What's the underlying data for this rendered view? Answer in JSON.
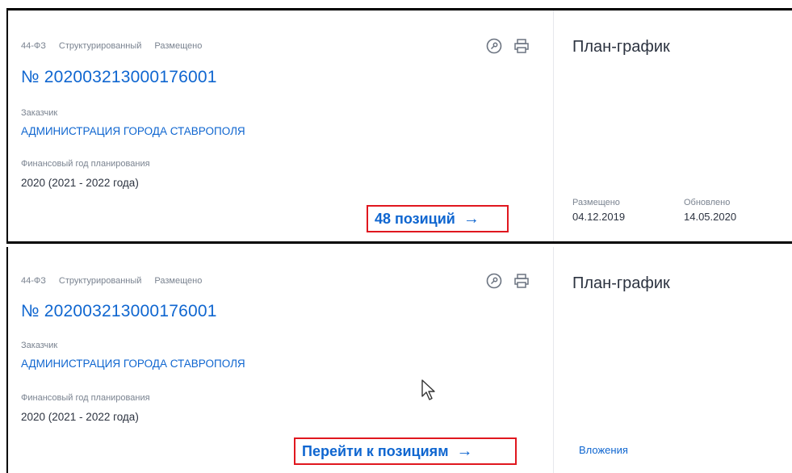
{
  "card_top": {
    "tags": [
      "44-ФЗ",
      "Структурированный",
      "Размещено"
    ],
    "reg_number": "№ 202003213000176001",
    "customer_label": "Заказчик",
    "customer_name": "АДМИНИСТРАЦИЯ ГОРОДА СТАВРОПОЛЯ",
    "year_label": "Финансовый год планирования",
    "year_value": "2020 (2021 - 2022 года)",
    "cta_label": "48 позиций",
    "cta_arrow": "→",
    "side_title": "План-график",
    "placed_label": "Размещено",
    "placed_date": "04.12.2019",
    "updated_label": "Обновлено",
    "updated_date": "14.05.2020"
  },
  "card_bottom": {
    "tags": [
      "44-ФЗ",
      "Структурированный",
      "Размещено"
    ],
    "reg_number": "№ 202003213000176001",
    "customer_label": "Заказчик",
    "customer_name": "АДМИНИСТРАЦИЯ ГОРОДА СТАВРОПОЛЯ",
    "year_label": "Финансовый год планирования",
    "year_value": "2020 (2021 - 2022 года)",
    "cta_label": "Перейти к позициям",
    "cta_arrow": "→",
    "side_title": "План-график",
    "attachments_label": "Вложения"
  },
  "icons": [
    "key-circle-icon",
    "printer-icon",
    "mouse-cursor-icon"
  ],
  "colors": {
    "link": "#0f66d0",
    "highlight": "#e0171f",
    "muted": "#7a8390",
    "text": "#2c3340"
  }
}
